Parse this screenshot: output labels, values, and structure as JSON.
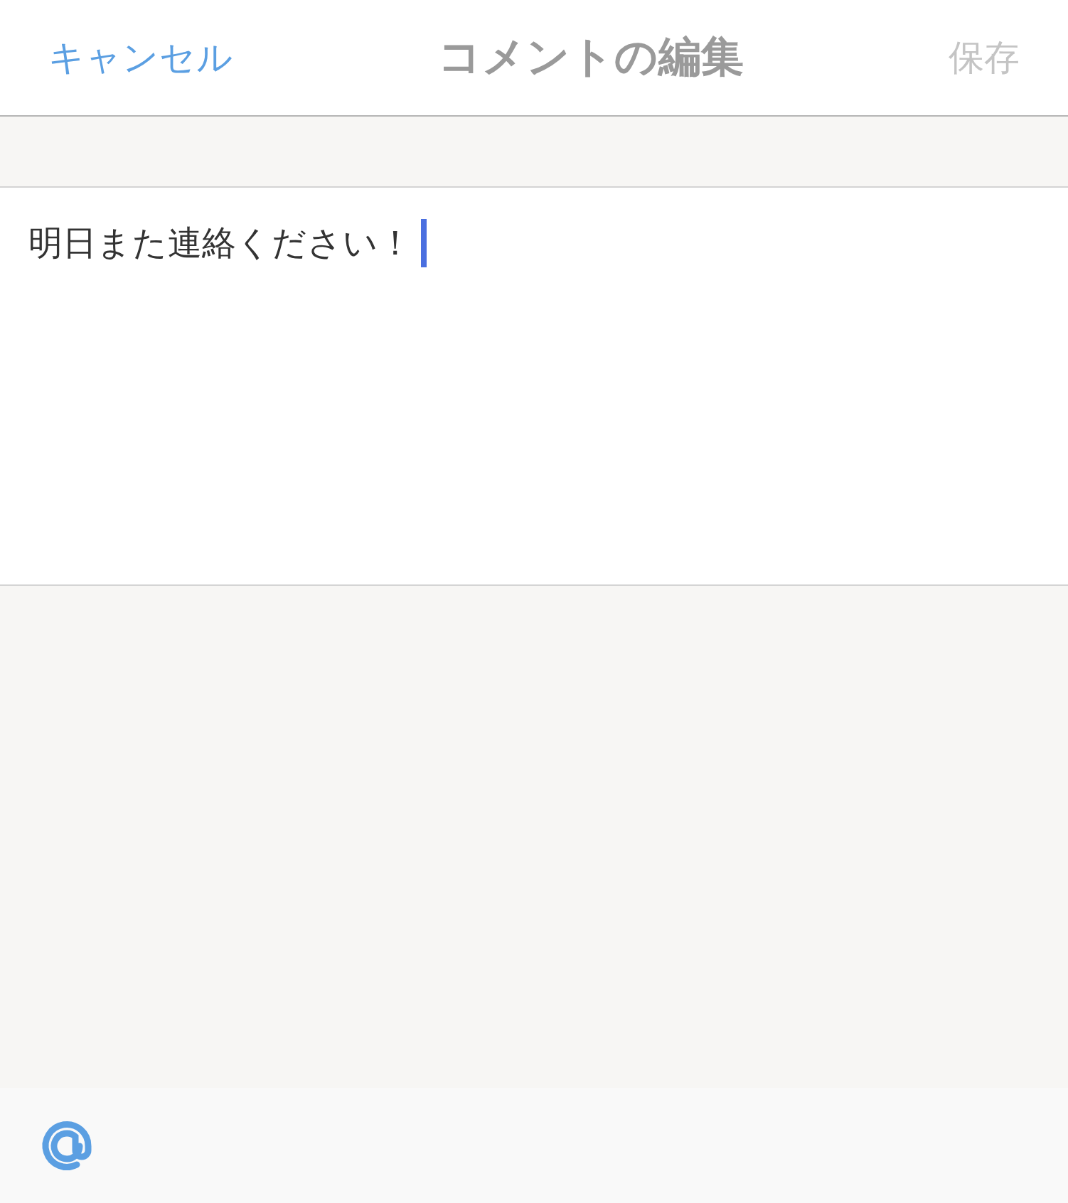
{
  "header": {
    "cancel": "キャンセル",
    "title": "コメントの編集",
    "save": {
      "label": "保存",
      "disabled": true
    }
  },
  "comment": {
    "value": "明日また連絡ください！",
    "focused": true
  }
}
